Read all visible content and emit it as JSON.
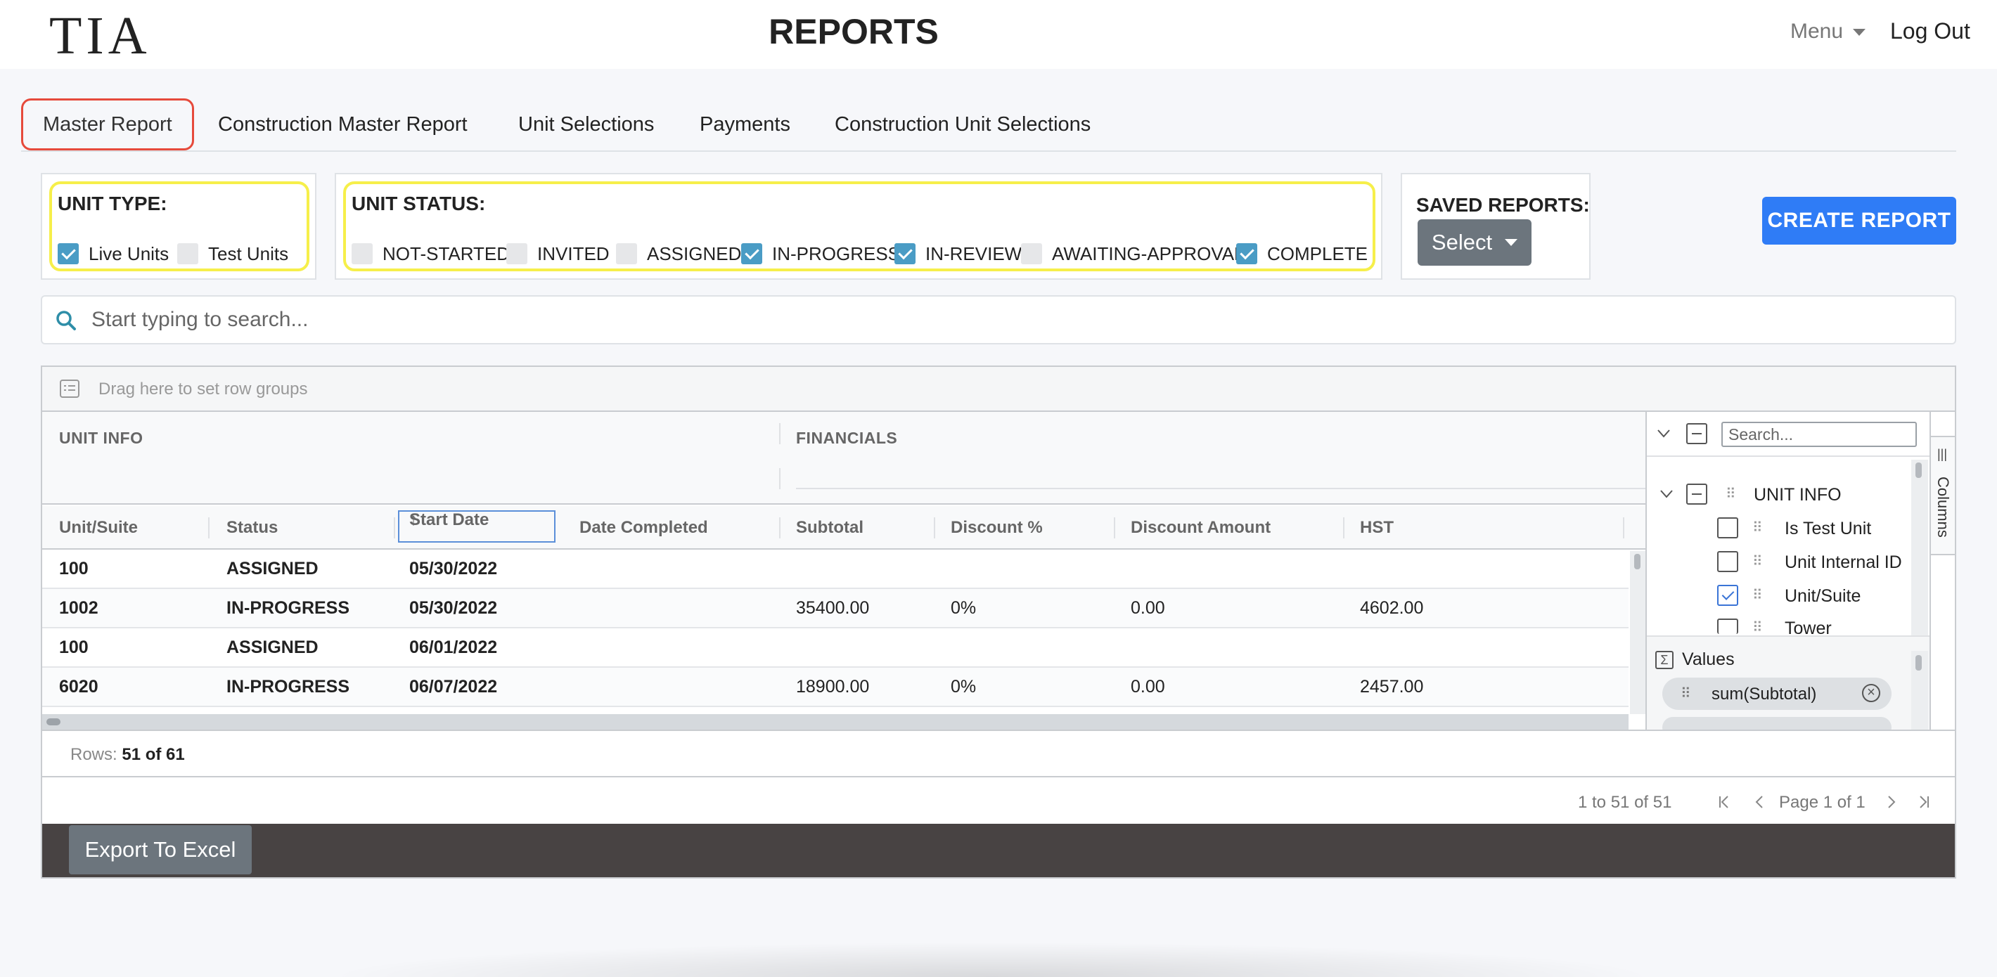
{
  "header": {
    "logo_text": "TIA",
    "title": "REPORTS",
    "menu_label": "Menu",
    "logout_label": "Log Out"
  },
  "tabs": [
    {
      "label": "Master Report",
      "active": true
    },
    {
      "label": "Construction Master Report",
      "active": false
    },
    {
      "label": "Unit Selections",
      "active": false
    },
    {
      "label": "Payments",
      "active": false
    },
    {
      "label": "Construction Unit Selections",
      "active": false
    }
  ],
  "unit_type": {
    "title": "UNIT TYPE:",
    "options": [
      {
        "label": "Live Units",
        "checked": true
      },
      {
        "label": "Test Units",
        "checked": false
      }
    ]
  },
  "unit_status": {
    "title": "UNIT STATUS:",
    "options": [
      {
        "label": "NOT-STARTED",
        "checked": false
      },
      {
        "label": "INVITED",
        "checked": false
      },
      {
        "label": "ASSIGNED",
        "checked": false
      },
      {
        "label": "IN-PROGRESS",
        "checked": true
      },
      {
        "label": "IN-REVIEW",
        "checked": true
      },
      {
        "label": "AWAITING-APPROVAL",
        "checked": false
      },
      {
        "label": "COMPLETE",
        "checked": true
      }
    ]
  },
  "saved_reports": {
    "title": "SAVED REPORTS:",
    "select_label": "Select"
  },
  "create_report_label": "CREATE REPORT",
  "search": {
    "placeholder": "Start typing to search..."
  },
  "grid": {
    "row_group_hint": "Drag here to set row groups",
    "groups": [
      "UNIT INFO",
      "FINANCIALS"
    ],
    "columns": [
      "Unit/Suite",
      "Status",
      "Start Date",
      "Date Completed",
      "Subtotal",
      "Discount %",
      "Discount Amount",
      "HST"
    ],
    "sort_indicator": "↑",
    "rows": [
      [
        "100",
        "ASSIGNED",
        "05/30/2022",
        "",
        "",
        "",
        "",
        ""
      ],
      [
        "1002",
        "IN-PROGRESS",
        "05/30/2022",
        "",
        "35400.00",
        "0%",
        "0.00",
        "4602.00"
      ],
      [
        "100",
        "ASSIGNED",
        "06/01/2022",
        "",
        "",
        "",
        "",
        ""
      ],
      [
        "6020",
        "IN-PROGRESS",
        "06/07/2022",
        "",
        "18900.00",
        "0%",
        "0.00",
        "2457.00"
      ]
    ]
  },
  "column_panel": {
    "search_placeholder": "Search...",
    "group_label": "UNIT INFO",
    "items": [
      {
        "label": "Is Test Unit",
        "checked": false
      },
      {
        "label": "Unit Internal ID",
        "checked": false
      },
      {
        "label": "Unit/Suite",
        "checked": true
      },
      {
        "label": "Tower",
        "checked": false
      }
    ],
    "values_label": "Values",
    "value_pill": "sum(Subtotal)",
    "side_tab_label": "Columns"
  },
  "status_bar": {
    "rows_label": "Rows:",
    "rows_value": "51 of 61"
  },
  "pager": {
    "summary": "1 to 51 of 51",
    "page_text": "Page 1 of 1"
  },
  "footer": {
    "export_label": "Export To Excel"
  }
}
